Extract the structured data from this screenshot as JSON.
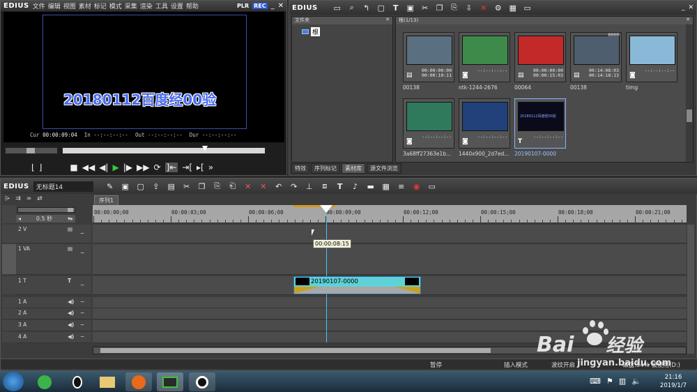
{
  "player": {
    "title": "EDIUS",
    "menu": [
      "文件",
      "编辑",
      "视图",
      "素材",
      "标记",
      "模式",
      "采集",
      "渲染",
      "工具",
      "设置",
      "帮助"
    ],
    "mode_plr": "PLR",
    "mode_rec": "REC",
    "preview_text": "20180112百度经00验",
    "cur_label": "Cur",
    "cur_value": "00:00:09:04",
    "in_label": "In",
    "in_value": "--:--:--:--",
    "out_label": "Out",
    "out_value": "--:--:--:--",
    "dur_label": "Dur",
    "dur_value": "--:--:--:--"
  },
  "bin": {
    "title": "EDIUS",
    "folder_panel_title": "文件夹",
    "root_folder": "根",
    "count": "根(1/13)",
    "clips": [
      {
        "name": "00138",
        "tc1": "00:00:00:00",
        "tc2": "00:00:10:11",
        "type": "video",
        "color": "#5a6f7f"
      },
      {
        "name": "ntk-1244-2676",
        "tc1": "--:--:--:--",
        "tc2": "",
        "type": "photo",
        "color": "#3d8a4a"
      },
      {
        "name": "00064",
        "tc1": "00:00:00:00",
        "tc2": "00:00:15:03",
        "type": "video",
        "color": "#c22a2a"
      },
      {
        "name": "00138",
        "tc1": "00:14:08:03",
        "tc2": "00:14:18:13",
        "type": "video",
        "color": "#4f5e6e",
        "badge": "0000"
      },
      {
        "name": "timg",
        "tc1": "--:--:--:--",
        "tc2": "",
        "type": "photo",
        "color": "#8ab9d8"
      },
      {
        "name": "3a68ff27363e1b...",
        "tc1": "--:--:--:--",
        "tc2": "",
        "type": "photo",
        "color": "#2f7a5c"
      },
      {
        "name": "1440x900_2d7ed...",
        "tc1": "--:--:--:--",
        "tc2": "",
        "type": "photo",
        "color": "#22417a"
      },
      {
        "name": "20190107-0000",
        "tc1": "--:--:--:--",
        "tc2": "",
        "type": "title",
        "color": "#0a0a1a",
        "selected": true
      }
    ],
    "title_clip_text": "20180112百度经00验",
    "tabs": [
      "特效",
      "序列标记",
      "素材库",
      "源文件浏览"
    ]
  },
  "timeline": {
    "title": "EDIUS",
    "project": "无标题14",
    "sequence_tab": "序列1",
    "zoom": "0.5 秒",
    "ruler": [
      "00:00:00;00",
      "00:00:03;00",
      "00:00:06;00",
      "00:00:09;00",
      "00:00:12;00",
      "00:00:15;00",
      "00:00:18;00",
      "00:00:21;00"
    ],
    "tooltip": "00:00:08:15",
    "tracks": [
      {
        "label": "2 V",
        "type": "V"
      },
      {
        "label": "1 VA",
        "type": "VA"
      },
      {
        "label": "1 T",
        "type": "T"
      },
      {
        "label": "1 A",
        "type": "A"
      },
      {
        "label": "2 A",
        "type": "A"
      },
      {
        "label": "3 A",
        "type": "A"
      },
      {
        "label": "4 A",
        "type": "A"
      }
    ],
    "clip_name": "20190107-0000",
    "status": {
      "pause": "暂停",
      "insert_mode": "插入模式",
      "ripple": "波纹开启",
      "disk": "磁盘:54% 被使用(D:)"
    }
  },
  "taskbar": {
    "time": "21:16",
    "date": "2019/1/7"
  },
  "watermark": {
    "text": "Bai",
    "text2": "经验",
    "url": "jingyan.baidu.com"
  }
}
